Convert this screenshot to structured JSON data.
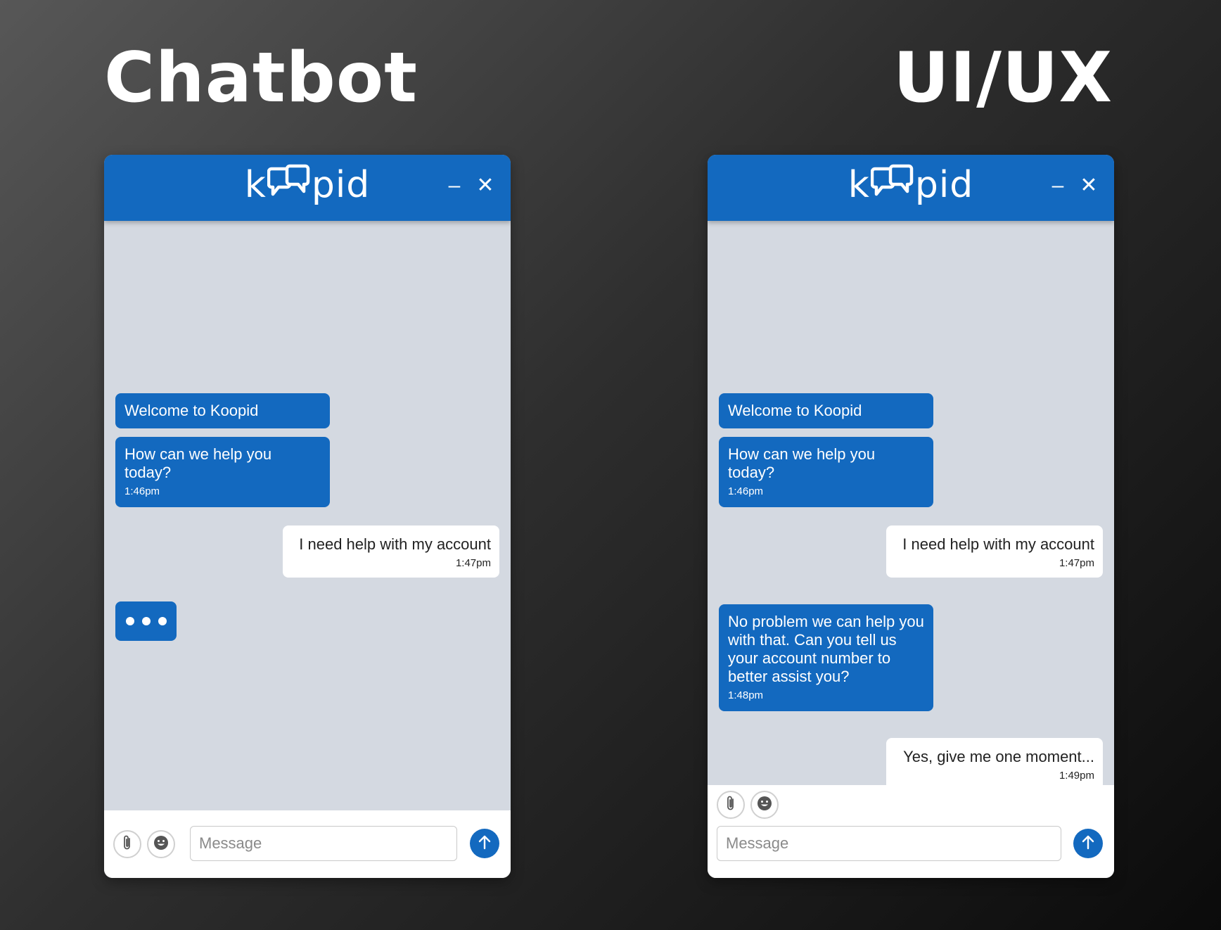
{
  "headings": {
    "left": "Chatbot",
    "right": "UI/UX"
  },
  "brand": {
    "logo_prefix": "k",
    "logo_suffix": "pid",
    "primary_color": "#1369bf",
    "chat_bg": "#d4d9e1"
  },
  "header_controls": {
    "minimize": "–",
    "close": "✕"
  },
  "widget1": {
    "messages": [
      {
        "sender": "bot",
        "text": "Welcome to Koopid"
      },
      {
        "sender": "bot",
        "text": "How can we help you today?",
        "time": "1:46pm"
      },
      {
        "sender": "user",
        "text": "I need help with my account",
        "time": "1:47pm"
      }
    ],
    "input_placeholder": "Message"
  },
  "widget2": {
    "messages": [
      {
        "sender": "bot",
        "text": "Welcome to Koopid"
      },
      {
        "sender": "bot",
        "text": "How can we help you today?",
        "time": "1:46pm"
      },
      {
        "sender": "user",
        "text": "I need help with my account",
        "time": "1:47pm"
      },
      {
        "sender": "bot",
        "text": "No problem we can help you with that. Can you tell us your account number to better assist you?",
        "time": "1:48pm"
      },
      {
        "sender": "user",
        "text": "Yes, give me one moment...",
        "time": "1:49pm"
      }
    ],
    "input_placeholder": "Message"
  },
  "icons": [
    "paperclip-icon",
    "emoji-icon",
    "send-arrow-icon",
    "chat-bubble-logo-icon"
  ]
}
